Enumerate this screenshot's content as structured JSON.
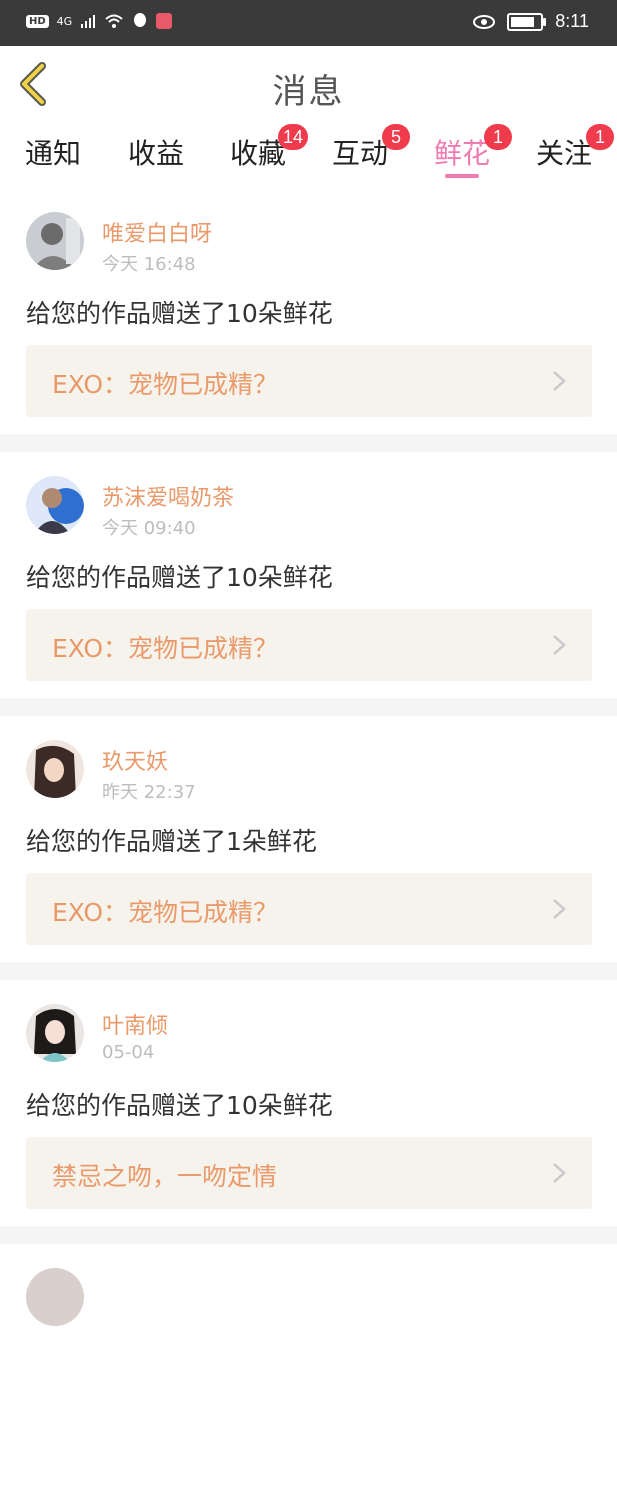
{
  "status_bar": {
    "hd": "HD",
    "signal": "4G",
    "time": "8:11"
  },
  "header": {
    "title": "消息",
    "back_icon": "chevron-left-icon"
  },
  "tabs": [
    {
      "label": "通知",
      "badge": ""
    },
    {
      "label": "收益",
      "badge": ""
    },
    {
      "label": "收藏",
      "badge": "14"
    },
    {
      "label": "互动",
      "badge": "5"
    },
    {
      "label": "鲜花",
      "badge": "1",
      "active": true
    },
    {
      "label": "关注",
      "badge": "1"
    }
  ],
  "colors": {
    "accent": "#f07bb0",
    "badge": "#ef3b4b",
    "name": "#ea9a6a",
    "work_bg": "#f5f3ec"
  },
  "messages": [
    {
      "name": "唯爱白白呀",
      "time": "今天 16:48",
      "text": "给您的作品赠送了10朵鲜花",
      "work": "EXO：宠物已成精？"
    },
    {
      "name": "苏沫爱喝奶茶",
      "time": "今天 09:40",
      "text": "给您的作品赠送了10朵鲜花",
      "work": "EXO：宠物已成精？"
    },
    {
      "name": "玖天妖",
      "time": "昨天 22:37",
      "text": "给您的作品赠送了1朵鲜花",
      "work": "EXO：宠物已成精？"
    },
    {
      "name": "叶南倾",
      "time": "05-04",
      "text": "给您的作品赠送了10朵鲜花",
      "work": "禁忌之吻，一吻定情"
    }
  ]
}
